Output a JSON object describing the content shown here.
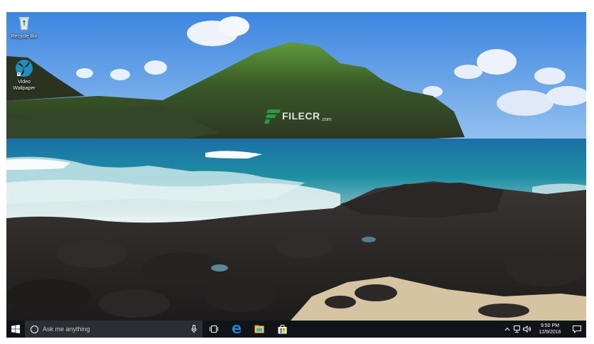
{
  "desktop": {
    "icons": [
      {
        "label": "Recycle Bin",
        "icon": "recycle-bin-icon"
      },
      {
        "label": "Video\nWallpaper",
        "label_line1": "Video",
        "label_line2": "Wallpaper",
        "icon": "video-wallpaper-icon"
      }
    ],
    "watermark": {
      "text": "FILECR",
      "suffix": ".com"
    }
  },
  "taskbar": {
    "search_placeholder": "Ask me anything",
    "pinned": [
      "task-view-icon",
      "edge-icon",
      "file-explorer-icon",
      "store-icon"
    ],
    "clock": {
      "time": "9:50 PM",
      "date": "12/9/2016"
    },
    "tray_icons": [
      "chevron-up-icon",
      "network-icon",
      "volume-icon",
      "notification-icon"
    ],
    "accent_blue": "#1e90e6"
  }
}
